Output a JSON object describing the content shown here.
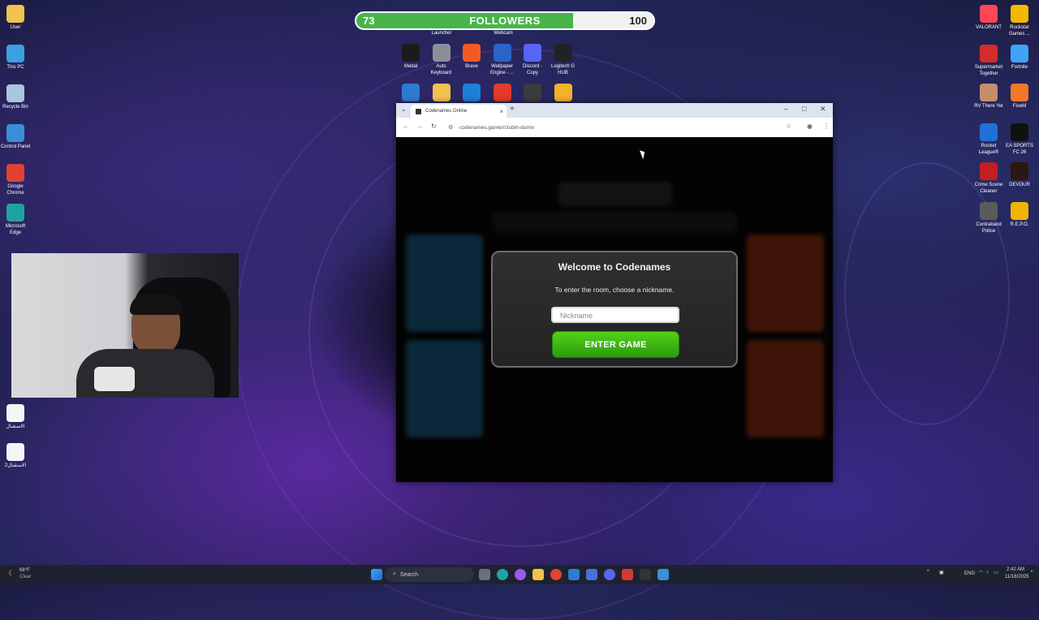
{
  "followers_bar": {
    "current": "73",
    "label": "FOLLOWERS",
    "goal": "100",
    "progress": 0.73
  },
  "desktop_left": [
    {
      "label": "User",
      "icon": "folder-icon",
      "color": "#f2c14e"
    },
    {
      "label": "This PC",
      "icon": "monitor-icon",
      "color": "#3aa0e0"
    },
    {
      "label": "Recycle Bin",
      "icon": "recycle-bin-icon",
      "color": "#a8c6e0"
    },
    {
      "label": "Control Panel",
      "icon": "control-panel-icon",
      "color": "#3b8fd6"
    },
    {
      "label": "Google Chrome",
      "icon": "chrome-icon",
      "color": "#e34133"
    },
    {
      "label": "Microsoft Edge",
      "icon": "edge-icon",
      "color": "#1fa3a0"
    }
  ],
  "desktop_left_bottom": [
    {
      "label": "الاستقبال",
      "icon": "video-file-icon",
      "color": "#f5f5f5"
    },
    {
      "label": "الاستقبال2",
      "icon": "video-file-icon",
      "color": "#f5f5f5"
    }
  ],
  "desktop_top_partial": [
    {
      "label": "Launcher"
    },
    {
      "label": "Webcam"
    }
  ],
  "desktop_top": [
    {
      "label": "Medal",
      "icon": "medal-icon",
      "color": "#1b1b1b"
    },
    {
      "label": "Auto Keyboard",
      "icon": "keyboard-icon",
      "color": "#8a8f9a"
    },
    {
      "label": "Brave",
      "icon": "brave-icon",
      "color": "#f25a24"
    },
    {
      "label": "Wallpaper Engine - ...",
      "icon": "wallpaper-engine-icon",
      "color": "#2a64c8"
    },
    {
      "label": "Discord - Copy",
      "icon": "discord-icon",
      "color": "#5865f2"
    },
    {
      "label": "Logitech G HUB",
      "icon": "logitech-icon",
      "color": "#222"
    }
  ],
  "desktop_top_row2": [
    {
      "icon": "notepad-icon",
      "color": "#2f7bd3"
    },
    {
      "icon": "folder-icon",
      "color": "#f2c14e"
    },
    {
      "icon": "app-icon",
      "color": "#1e7fd8"
    },
    {
      "icon": "ea-icon",
      "color": "#e43a2a"
    },
    {
      "icon": "obs-icon",
      "color": "#3c3c3c"
    },
    {
      "icon": "chat-icon",
      "color": "#f2b22a"
    }
  ],
  "desktop_right_col1": [
    {
      "label": "VALORANT",
      "icon": "valorant-icon",
      "color": "#ff4655"
    },
    {
      "label": "Supermarket Together",
      "icon": "supermarket-icon",
      "color": "#d42b2b"
    },
    {
      "label": "RV There Yet",
      "icon": "rv-icon",
      "color": "#c48f6a"
    },
    {
      "label": "Rocket League®",
      "icon": "rocket-league-icon",
      "color": "#2170d8"
    },
    {
      "label": "Crime Scene Cleaner",
      "icon": "crime-scene-icon",
      "color": "#c21f1f"
    },
    {
      "label": "Contraband Police",
      "icon": "police-icon",
      "color": "#5a5a5a"
    }
  ],
  "desktop_right_col2": [
    {
      "label": "Rockstar Games ...",
      "icon": "rockstar-icon",
      "color": "#f5b800"
    },
    {
      "label": "Fortnite",
      "icon": "fortnite-icon",
      "color": "#3fa4f5"
    },
    {
      "label": "FiveM",
      "icon": "fivem-icon",
      "color": "#f2772a"
    },
    {
      "label": "EA SPORTS FC 26",
      "icon": "fc26-icon",
      "color": "#111"
    },
    {
      "label": "DEVOUR",
      "icon": "devour-icon",
      "color": "#2b1810"
    },
    {
      "label": "R.E.P.O.",
      "icon": "repo-icon",
      "color": "#f0b400"
    }
  ],
  "browser": {
    "tab_title": "Codenames Online",
    "url": "codenames.game/r/zubih-domiv",
    "modal": {
      "title": "Welcome to Codenames",
      "prompt": "To enter the room, choose a nickname.",
      "nickname_placeholder": "Nickname",
      "enter_button": "ENTER GAME"
    }
  },
  "taskbar": {
    "weather_temp": "68°F",
    "weather_desc": "Clear",
    "search_placeholder": "Search",
    "language": "ENG",
    "time": "2:42 AM",
    "date": "11/16/2025"
  },
  "colors": {
    "accent_green": "#3fb91a",
    "followers_green": "#48b548"
  }
}
